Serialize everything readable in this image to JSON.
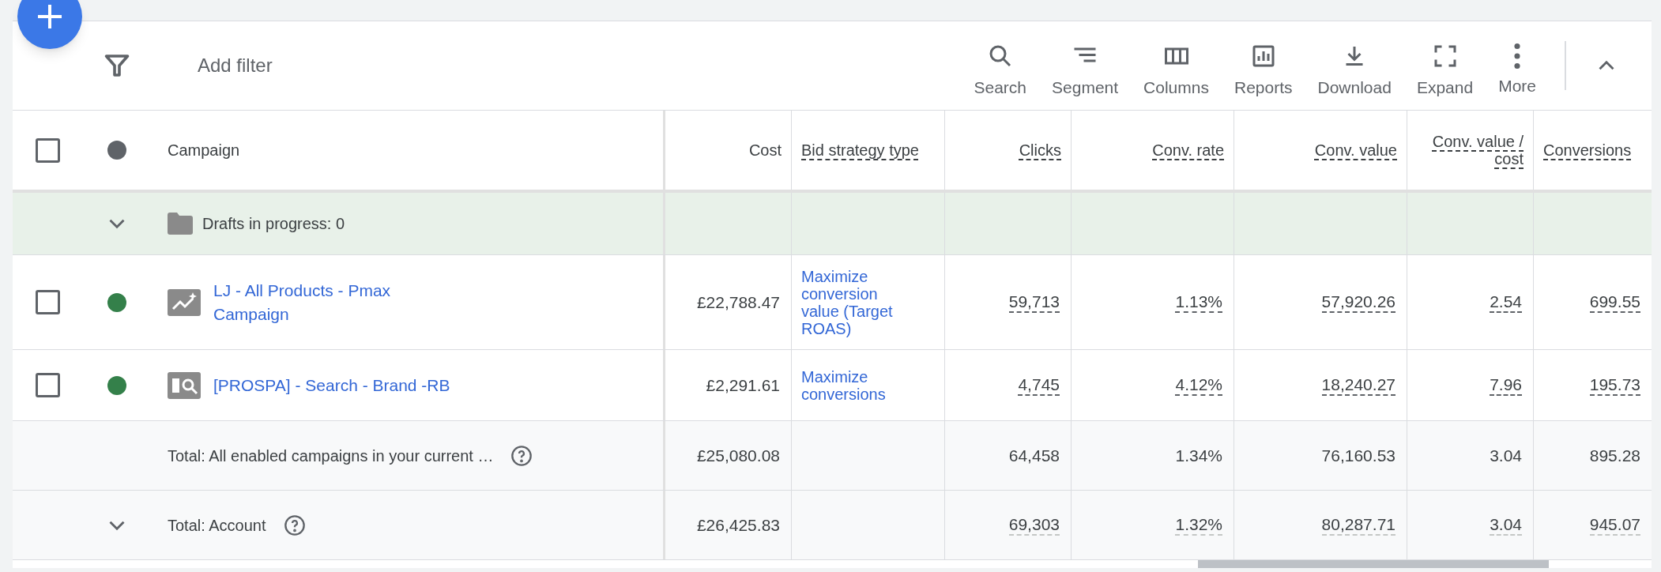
{
  "toolbar": {
    "filter_placeholder": "Add filter",
    "actions": [
      {
        "label": "Search"
      },
      {
        "label": "Segment"
      },
      {
        "label": "Columns"
      },
      {
        "label": "Reports"
      },
      {
        "label": "Download"
      },
      {
        "label": "Expand"
      },
      {
        "label": "More"
      }
    ]
  },
  "table": {
    "select_all_checked": false,
    "columns": [
      {
        "label": "Campaign",
        "dashed": false
      },
      {
        "label": "Cost",
        "dashed": false
      },
      {
        "label": "Bid strategy type",
        "dashed": true
      },
      {
        "label": "Clicks",
        "dashed": true
      },
      {
        "label": "Conv. rate",
        "dashed": true
      },
      {
        "label": "Conv. value",
        "dashed": true
      },
      {
        "label": "Conv. value / cost",
        "dashed": true
      },
      {
        "label": "Conversions",
        "dashed": true
      }
    ],
    "drafts": {
      "text": "Drafts in progress: 0"
    },
    "rows": [
      {
        "name": "LJ - All Products - Pmax Campaign",
        "kind": "performance",
        "checked": false,
        "color": "#34804a",
        "cost": "£22,788.47",
        "bid_strategy": "Maximize conversion value (Target ROAS)",
        "metrics": [
          "59,713",
          "1.13%",
          "57,920.26",
          "2.54",
          "699.55"
        ]
      },
      {
        "name": "[PROSPA] - Search - Brand -RB",
        "kind": "search",
        "checked": false,
        "color": "#34804a",
        "cost": "£2,291.61",
        "bid_strategy": "Maximize conversions",
        "metrics": [
          "4,745",
          "4.12%",
          "18,240.27",
          "7.96",
          "195.73"
        ]
      }
    ],
    "totals": [
      {
        "label": "Total: All enabled campaigns in your current …",
        "expandable": false,
        "dashed": false,
        "cost": "£25,080.08",
        "metrics": [
          "64,458",
          "1.34%",
          "76,160.53",
          "3.04",
          "895.28"
        ]
      },
      {
        "label": "Total: Account",
        "expandable": true,
        "dashed": true,
        "cost": "£26,425.83",
        "metrics": [
          "69,303",
          "1.32%",
          "80,287.71",
          "3.04",
          "945.07"
        ]
      }
    ]
  }
}
